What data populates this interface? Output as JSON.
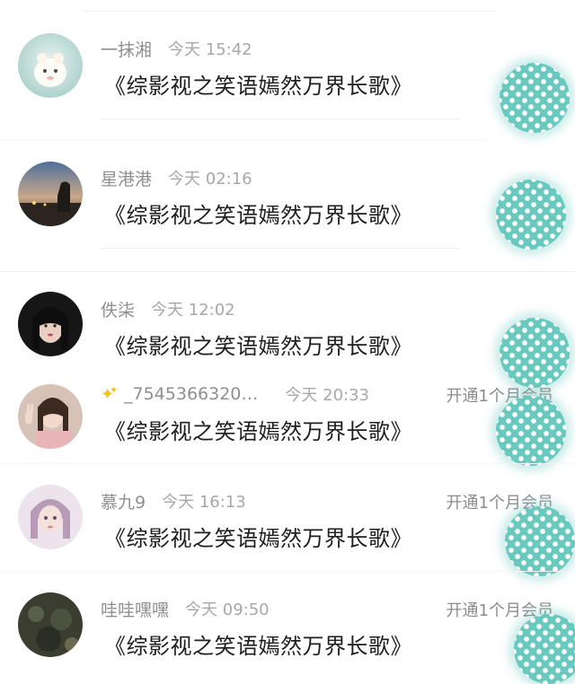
{
  "comments": [
    {
      "username": "一抹湘",
      "time": "今天 15:42",
      "text": "《综影视之笑语嫣然万界长歌》",
      "vip_label": "",
      "avatar_icon": "hamster-avatar-icon"
    },
    {
      "username": "星港港",
      "time": "今天 02:16",
      "text": "《综影视之笑语嫣然万界长歌》",
      "vip_label": "",
      "avatar_icon": "sunset-avatar-icon"
    },
    {
      "username": "佚柒",
      "time": "今天 12:02",
      "text": "《综影视之笑语嫣然万界长歌》",
      "vip_label": "",
      "avatar_icon": "girl-avatar-icon"
    },
    {
      "username": "_7545366320…",
      "time": "今天 20:33",
      "text": "《综影视之笑语嫣然万界长歌》",
      "vip_label": "开通1个月会员",
      "avatar_icon": "girl-peace-avatar-icon",
      "prefix_icon": "sparkle-emoji-icon"
    },
    {
      "username": "慕九9",
      "time": "今天 16:13",
      "text": "《综影视之笑语嫣然万界长歌》",
      "vip_label": "开通1个月会员",
      "avatar_icon": "doll-avatar-icon"
    },
    {
      "username": "哇哇嘿嘿",
      "time": "今天 09:50",
      "text": "《综影视之笑语嫣然万界长歌》",
      "vip_label": "开通1个月会员",
      "avatar_icon": "landscape-avatar-icon"
    }
  ],
  "colors": {
    "thumb_teal": "#6ac9bf",
    "meta_gray": "#9a9a9a",
    "text_dark": "#1e1e1e"
  }
}
